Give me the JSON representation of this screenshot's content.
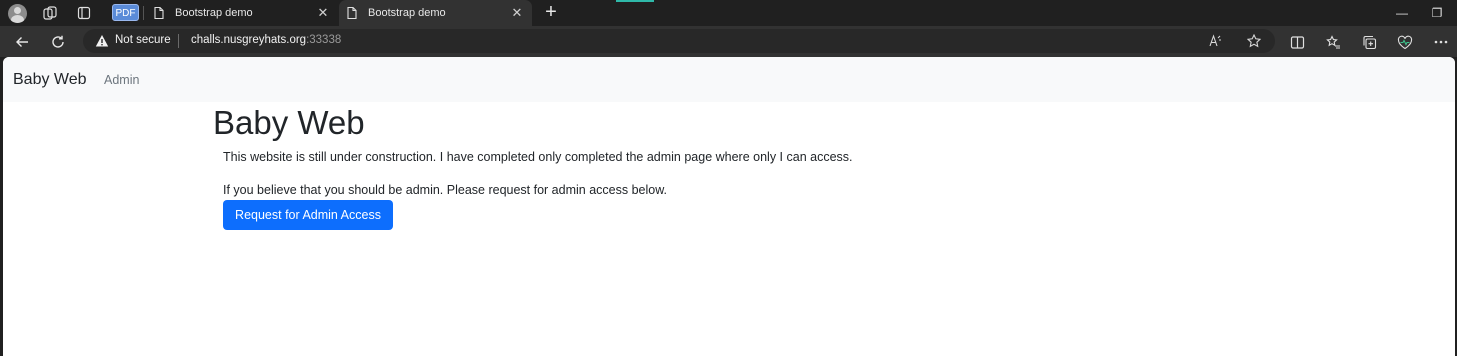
{
  "tabs": [
    {
      "label": "Bootstrap demo",
      "active": false
    },
    {
      "label": "Bootstrap demo",
      "active": true
    }
  ],
  "pdf_badge": "PDF",
  "new_tab_symbol": "+",
  "address_bar": {
    "security_label": "Not secure",
    "host": "challs.nusgreyhats.org",
    "port": ":33338"
  },
  "window_controls": {
    "minimize": "—",
    "restore": "❐"
  },
  "page": {
    "navbar": {
      "brand": "Baby Web",
      "links": [
        "Admin"
      ]
    },
    "heading": "Baby Web",
    "paragraph1": "This website is still under construction. I have completed only completed the admin page where only I can access.",
    "paragraph2": "If you believe that you should be admin. Please request for admin access below.",
    "button_label": "Request for Admin Access"
  },
  "colors": {
    "chrome_bg": "#202020",
    "toolbar_bg": "#323232",
    "navbar_bg": "#f8f9fa",
    "primary_button": "#0d6efd"
  }
}
